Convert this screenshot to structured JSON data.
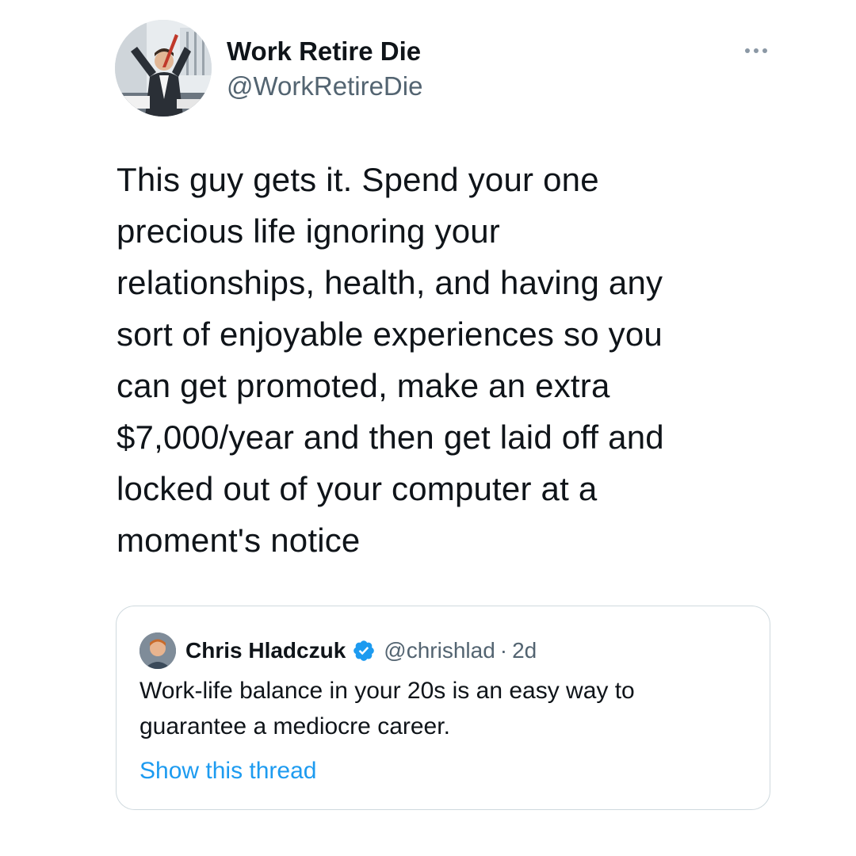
{
  "author": {
    "display_name": "Work Retire Die",
    "handle": "@WorkRetireDie",
    "avatar_icon": "office-worker-avatar"
  },
  "menu": {
    "icon": "more-horizontal-icon"
  },
  "tweet": {
    "lines": [
      "This guy gets it. Spend your one",
      "precious life ignoring your",
      "relationships, health, and having any",
      "sort of enjoyable experiences so you",
      "can get promoted, make an extra",
      "$7,000/year and then get laid off and",
      "locked out of your computer at a",
      "moment's notice"
    ]
  },
  "quoted_tweet": {
    "display_name": "Chris Hladczuk",
    "verified_icon": "verified-badge-icon",
    "handle": "@chrishlad",
    "separator": "·",
    "time": "2d",
    "lines": [
      "Work-life balance in your 20s is an easy way to",
      "guarantee a mediocre career."
    ],
    "link_label": "Show this thread"
  },
  "colors": {
    "text": "#0f1419",
    "secondary": "#536471",
    "link": "#1d9bf0",
    "border": "#cfd9de",
    "verified": "#1d9bf0"
  }
}
